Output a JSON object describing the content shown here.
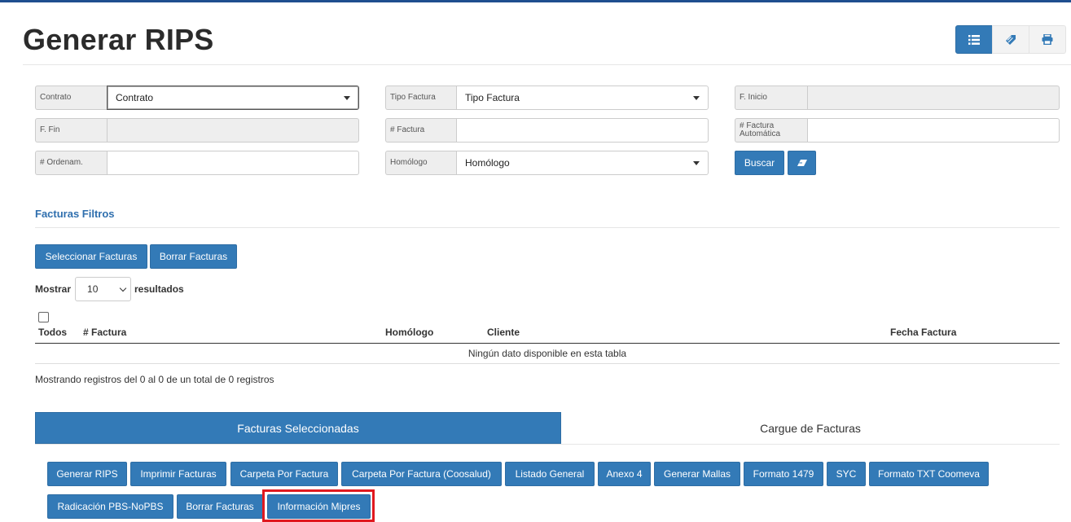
{
  "page": {
    "title": "Generar RIPS"
  },
  "toolbar": {
    "list_icon": "list-icon",
    "tag_icon": "tag-icon",
    "print_icon": "print-icon"
  },
  "filters": {
    "contrato": {
      "label": "Contrato",
      "value": "Contrato"
    },
    "tipo_factura": {
      "label": "Tipo Factura",
      "value": "Tipo Factura"
    },
    "f_inicio": {
      "label": "F. Inicio",
      "value": ""
    },
    "f_fin": {
      "label": "F. Fin",
      "value": ""
    },
    "num_factura": {
      "label": "# Factura",
      "value": ""
    },
    "factura_automatica": {
      "label_line1": "# Factura",
      "label_line2": "Automática",
      "value": ""
    },
    "ordenam": {
      "label": "# Ordenam.",
      "value": ""
    },
    "homologo": {
      "label": "Homólogo",
      "value": "Homólogo"
    },
    "buscar_label": "Buscar",
    "clear_icon": "eraser-icon"
  },
  "facturas_filtros": {
    "title": "Facturas Filtros",
    "seleccionar_label": "Seleccionar Facturas",
    "borrar_label": "Borrar Facturas",
    "mostrar": "Mostrar",
    "length_value": "10",
    "resultados": "resultados",
    "columns": [
      "Todos",
      "# Factura",
      "Homólogo",
      "Cliente",
      "Fecha Factura"
    ],
    "empty_message": "Ningún dato disponible en esta tabla",
    "info": "Mostrando registros del 0 al 0 de un total de 0 registros"
  },
  "tabs": [
    "Facturas Seleccionadas",
    "Cargue de Facturas"
  ],
  "actions": [
    "Generar RIPS",
    "Imprimir Facturas",
    "Carpeta Por Factura",
    "Carpeta Por Factura (Coosalud)",
    "Listado General",
    "Anexo 4",
    "Generar Mallas",
    "Formato 1479",
    "SYC",
    "Formato TXT Coomeva",
    "Radicación PBS-NoPBS",
    "Borrar Facturas",
    "Información Mipres"
  ],
  "colors": {
    "primary": "#337ab7",
    "title_blue": "#2f6fae",
    "highlight": "#e0191f",
    "top_bar": "#1f4f8f"
  }
}
